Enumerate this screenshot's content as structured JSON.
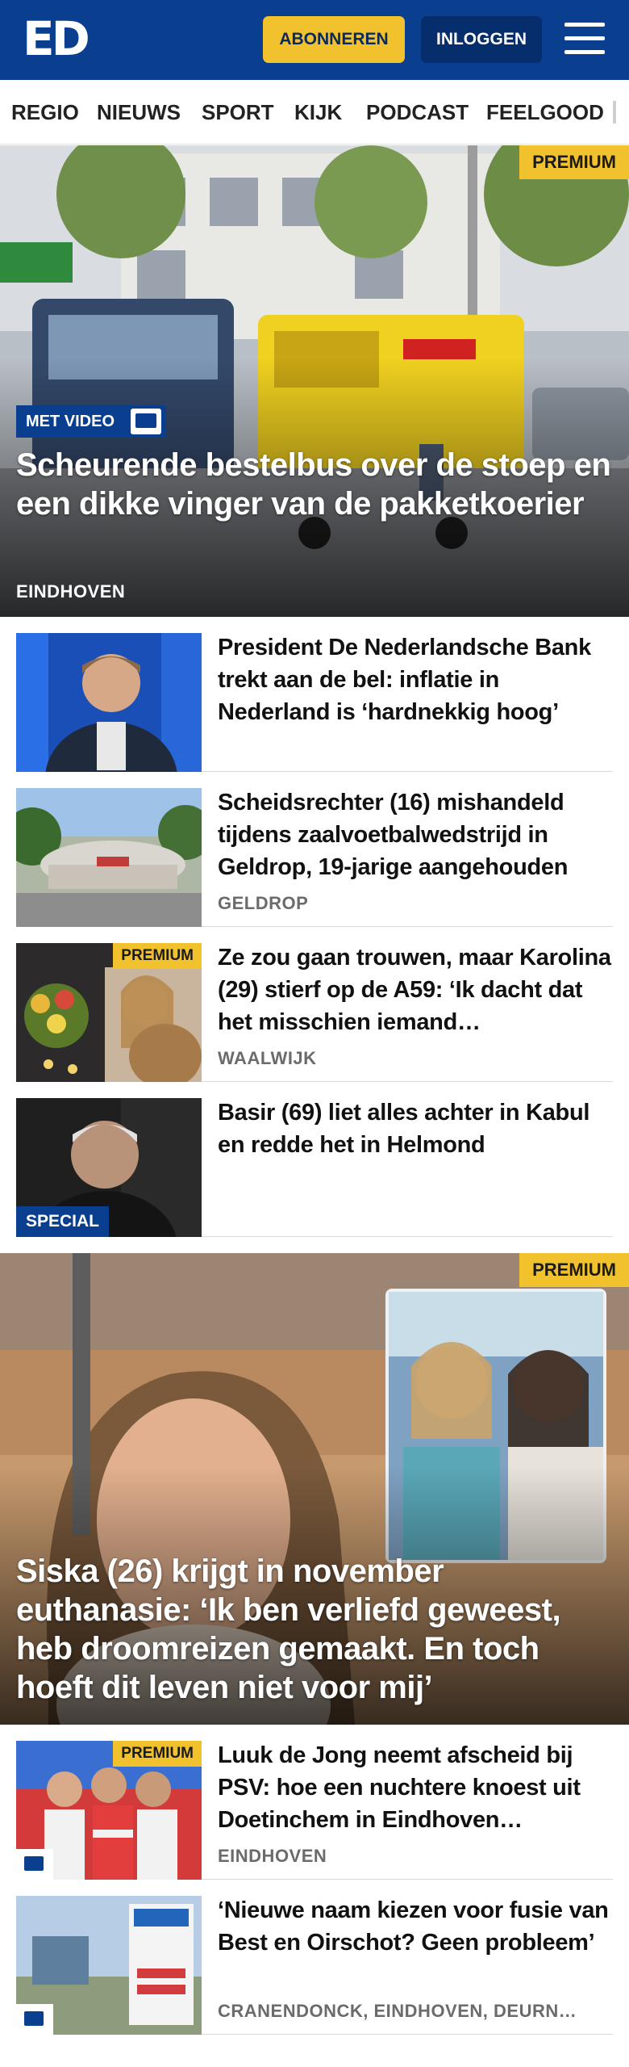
{
  "header": {
    "logo_text": "ED",
    "subscribe_label": "ABONNEREN",
    "login_label": "INLOGGEN",
    "menu_icon": "hamburger-menu-icon",
    "brand_color": "#0a3f8f",
    "accent_color": "#f2c12e"
  },
  "nav": {
    "items": [
      "REGIO",
      "NIEUWS",
      "SPORT",
      "KIJK",
      "PODCAST",
      "FEELGOOD"
    ]
  },
  "hero": {
    "badge": "PREMIUM",
    "video_tag": "MET VIDEO",
    "title": "Scheurende bestelbus over de stoep en een dikke vinger van de pakketkoe­rier",
    "location": "EINDHOVEN"
  },
  "articles": [
    {
      "title": "President De Nederlandsche Bank trekt aan de bel: inflatie in Nederland is ‘hardnekkig hoog’",
      "location": ""
    },
    {
      "title": "Scheidsrechter (16) mishandeld tijdens zaalvoetbalwedstrijd in Geldrop, 19-jarige aangehouden",
      "location": "GELDROP"
    },
    {
      "title": "Ze zou gaan trouwen, maar Karolina (29) stierf op de A59: ‘Ik dacht dat het misschien iemand…",
      "location": "WAALWIJK",
      "badge": "PREMIUM"
    },
    {
      "title": "Basir (69) liet alles achter in Kabul en redde het in Helmond",
      "location": "",
      "tag": "SPECIAL"
    }
  ],
  "hero2": {
    "badge": "PREMIUM",
    "title": "Siska (26) krijgt in november euthanasie: ‘Ik ben verliefd geweest, heb droomreizen gemaakt. En toch hoeft dit leven niet voor mij’"
  },
  "articles2": [
    {
      "title": "Luuk de Jong neemt afscheid bij PSV: hoe een nuchtere knoest uit Doetinchem in Eindhoven…",
      "location": "EINDHOVEN",
      "badge": "PREMIUM"
    },
    {
      "title": "‘Nieuwe naam kiezen voor fusie van Best en Oirschot? Geen probleem’",
      "location": "CRANENDONCK, EINDHOVEN, DEURN…"
    }
  ]
}
